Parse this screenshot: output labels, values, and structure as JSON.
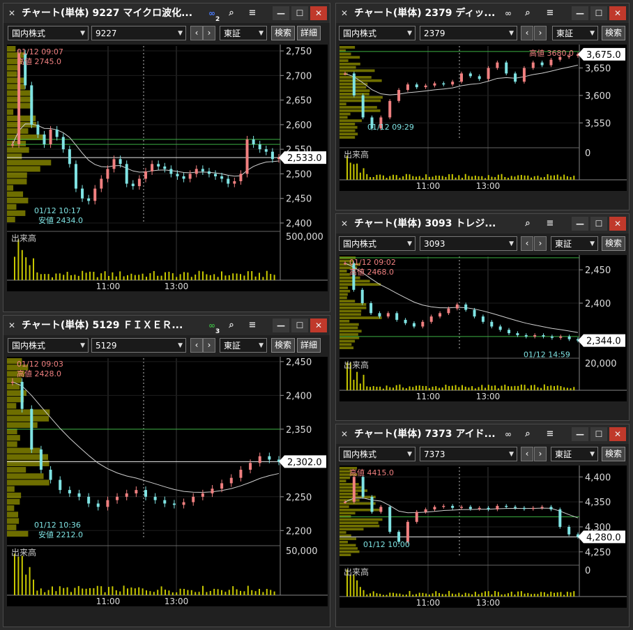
{
  "colors": {
    "background": "#000000",
    "grid": "#3a3a3a",
    "price_up": "#f08080",
    "price_down": "#7fe3e3",
    "volume": "#c8c800",
    "ma_line": "#d0d0d0",
    "hline_green": "#3cb043",
    "hline_white": "#e8e8e8",
    "label_high": "#f08080",
    "label_low": "#7fe3e3"
  },
  "icons": {
    "pin": "✕",
    "link": "🔗",
    "search": "🔍",
    "menu": "≡",
    "minimize": "—",
    "maximize": "☐",
    "close": "✕"
  },
  "panels": [
    {
      "title": "チャート(単体) 9227 マイクロ波化...",
      "link_badge": "2",
      "market": "国内株式",
      "code": "9227",
      "exchange": "東証",
      "search_label": "検索",
      "detail_label": "詳細",
      "volume_label": "出来高",
      "high_time": "01/12 09:07",
      "high_label": "高値 2745.0",
      "low_time": "01/12 10:17",
      "low_label": "安値 2434.0",
      "current_price": "2,533.0",
      "y_ticks": [
        "2,750",
        "2,700",
        "2,650",
        "2,600",
        "2,550",
        "2,500",
        "2,450",
        "2,400"
      ],
      "volume_tick": "500,000",
      "x_ticks": [
        "11:00",
        "13:00"
      ]
    },
    {
      "title": "チャート(単体) 2379 ディッ...",
      "market": "国内株式",
      "code": "2379",
      "exchange": "東証",
      "search_label": "検索",
      "volume_label": "出来高",
      "high_label": "高値 3680.0",
      "low_time": "01/12 09:29",
      "current_price": "3,675.0",
      "y_ticks": [
        "3,650",
        "3,600",
        "3,550"
      ],
      "volume_tick": "0",
      "x_ticks": [
        "11:00",
        "13:00"
      ]
    },
    {
      "title": "チャート(単体) 3093 トレジ...",
      "market": "国内株式",
      "code": "3093",
      "exchange": "東証",
      "search_label": "検索",
      "volume_label": "出来高",
      "high_time": "01/12 09:02",
      "high_label": "高値 2468.0",
      "low_time": "01/12 14:59",
      "current_price": "2,344.0",
      "y_ticks": [
        "2,450",
        "2,400"
      ],
      "volume_tick": "20,000",
      "x_ticks": [
        "11:00",
        "13:00"
      ]
    },
    {
      "title": "チャート(単体) 5129 ＦＩＸＥＲ...",
      "link_badge": "3",
      "market": "国内株式",
      "code": "5129",
      "exchange": "東証",
      "search_label": "検索",
      "detail_label": "詳細",
      "volume_label": "出来高",
      "high_time": "01/12 09:03",
      "high_label": "高値 2428.0",
      "low_time": "01/12 10:36",
      "low_label": "安値 2212.0",
      "current_price": "2,302.0",
      "y_ticks": [
        "2,450",
        "2,400",
        "2,350",
        "2,300",
        "2,250",
        "2,200"
      ],
      "volume_tick": "50,000",
      "x_ticks": [
        "11:00",
        "13:00"
      ]
    },
    {
      "title": "チャート(単体) 7373 アイド...",
      "market": "国内株式",
      "code": "7373",
      "exchange": "東証",
      "search_label": "検索",
      "volume_label": "出来高",
      "high_label": "高値 4415.0",
      "low_time": "01/12 10:00",
      "current_price": "4,280.0",
      "y_ticks": [
        "4,400",
        "4,350",
        "4,300",
        "4,250"
      ],
      "volume_tick": "0",
      "x_ticks": [
        "11:00",
        "13:00"
      ]
    }
  ],
  "chart_data": [
    {
      "type": "candlestick",
      "code": "9227",
      "ylim": [
        2400,
        2760
      ],
      "x": [
        "09:00",
        "15:00"
      ],
      "x_ticks": [
        "11:00",
        "13:00"
      ],
      "close": [
        2560,
        2745,
        2680,
        2600,
        2580,
        2560,
        2590,
        2575,
        2550,
        2520,
        2470,
        2450,
        2445,
        2470,
        2490,
        2510,
        2530,
        2520,
        2480,
        2475,
        2490,
        2505,
        2520,
        2515,
        2510,
        2500,
        2495,
        2490,
        2500,
        2510,
        2505,
        2500,
        2495,
        2490,
        2480,
        2485,
        2500,
        2570,
        2560,
        2550,
        2545,
        2530,
        2533
      ],
      "hlines": [
        2570,
        2560,
        2533
      ],
      "current": 2533.0
    },
    {
      "type": "candlestick",
      "code": "2379",
      "ylim": [
        3520,
        3690
      ],
      "x": [
        "09:00",
        "15:00"
      ],
      "x_ticks": [
        "11:00",
        "13:00"
      ],
      "close": [
        3640,
        3600,
        3560,
        3540,
        3560,
        3590,
        3610,
        3620,
        3615,
        3618,
        3622,
        3620,
        3625,
        3640,
        3635,
        3630,
        3650,
        3660,
        3640,
        3625,
        3650,
        3660,
        3655,
        3665,
        3670,
        3672,
        3675
      ],
      "hlines": [
        3680
      ],
      "current": 3675.0
    },
    {
      "type": "candlestick",
      "code": "3093",
      "ylim": [
        2330,
        2470
      ],
      "x": [
        "09:00",
        "15:00"
      ],
      "x_ticks": [
        "11:00",
        "13:00"
      ],
      "close": [
        2460,
        2420,
        2400,
        2385,
        2380,
        2385,
        2375,
        2370,
        2365,
        2372,
        2380,
        2385,
        2392,
        2398,
        2390,
        2380,
        2372,
        2365,
        2360,
        2355,
        2352,
        2350,
        2352,
        2350,
        2348,
        2350,
        2346,
        2344
      ],
      "hlines": [
        2468,
        2350
      ],
      "current": 2344.0
    },
    {
      "type": "candlestick",
      "code": "5129",
      "ylim": [
        2190,
        2455
      ],
      "x": [
        "09:00",
        "15:00"
      ],
      "x_ticks": [
        "11:00",
        "13:00"
      ],
      "close": [
        2420,
        2380,
        2320,
        2290,
        2275,
        2260,
        2255,
        2250,
        2240,
        2235,
        2245,
        2250,
        2255,
        2260,
        2250,
        2245,
        2240,
        2238,
        2242,
        2250,
        2255,
        2262,
        2270,
        2278,
        2290,
        2300,
        2310,
        2305,
        2302
      ],
      "hlines": [
        2350,
        2302
      ],
      "current": 2302.0
    },
    {
      "type": "candlestick",
      "code": "7373",
      "ylim": [
        4240,
        4420
      ],
      "x": [
        "09:00",
        "15:00"
      ],
      "x_ticks": [
        "11:00",
        "13:00"
      ],
      "close": [
        4350,
        4400,
        4360,
        4330,
        4340,
        4290,
        4270,
        4310,
        4330,
        4335,
        4340,
        4342,
        4338,
        4340,
        4336,
        4338,
        4335,
        4342,
        4340,
        4338,
        4336,
        4338,
        4340,
        4335,
        4300,
        4285,
        4280
      ],
      "hlines": [
        4320,
        4280
      ],
      "current": 4280.0
    }
  ]
}
